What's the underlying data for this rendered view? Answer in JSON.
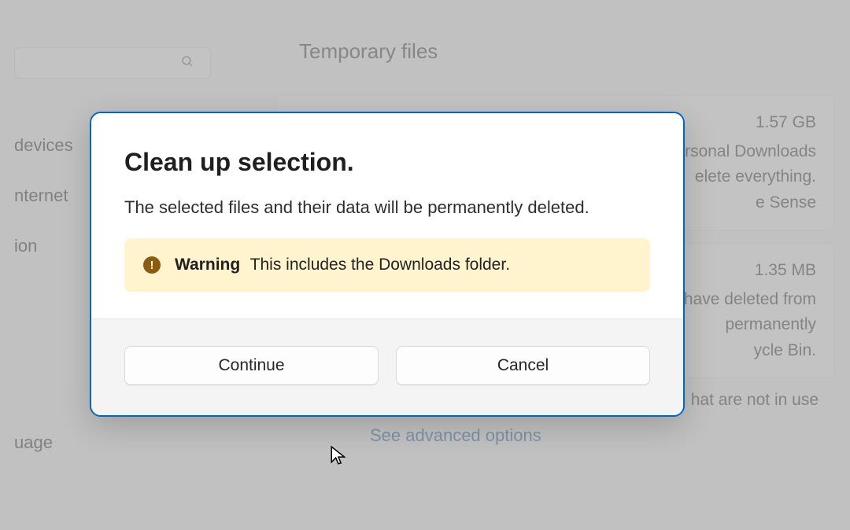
{
  "background": {
    "page_title": "Temporary files",
    "nav_items": [
      "devices",
      "nternet",
      "ion",
      "uage"
    ],
    "cards": [
      {
        "size": "1.57 GB",
        "desc_lines": [
          "ersonal Downloads",
          "elete everything.",
          "e Sense"
        ]
      },
      {
        "size": "1.35 MB",
        "desc_lines": [
          "have deleted from",
          "permanently",
          "ycle Bin."
        ]
      },
      {
        "size": "",
        "desc_lines": [
          "hat are not in use"
        ]
      }
    ],
    "advanced_link": "See advanced options"
  },
  "dialog": {
    "title": "Clean up selection.",
    "message": "The selected files and their data will be permanently deleted.",
    "warning_label": "Warning",
    "warning_text": "This includes the Downloads folder.",
    "continue_label": "Continue",
    "cancel_label": "Cancel"
  }
}
